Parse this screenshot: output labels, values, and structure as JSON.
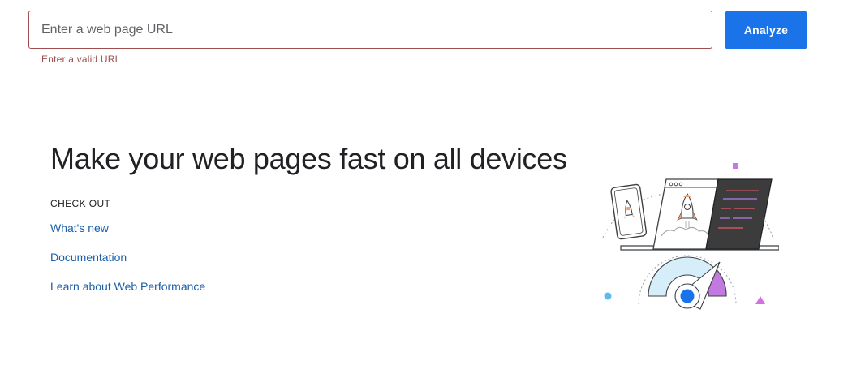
{
  "search": {
    "placeholder": "Enter a web page URL",
    "value": "",
    "error": "Enter a valid URL"
  },
  "analyze_button": {
    "label": "Analyze"
  },
  "hero": {
    "headline": "Make your web pages fast on all devices",
    "section_label": "CHECK OUT",
    "links": [
      {
        "label": "What's new"
      },
      {
        "label": "Documentation"
      },
      {
        "label": "Learn about Web Performance"
      }
    ]
  },
  "illustration": {
    "icon": "pagespeed-illustration"
  },
  "colors": {
    "accent": "#1a73e8",
    "error": "#a04d4d",
    "link": "#1a5fa8"
  }
}
